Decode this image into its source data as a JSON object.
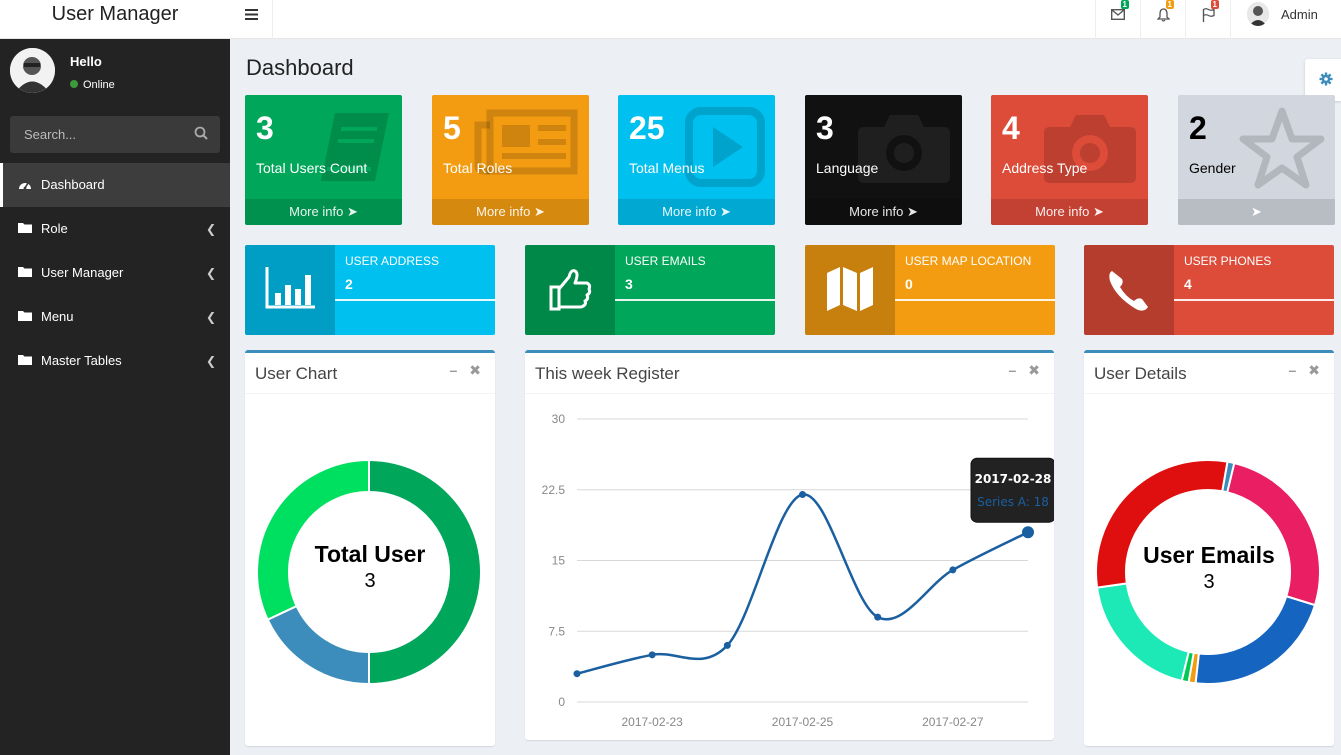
{
  "app": {
    "title": "User Manager"
  },
  "topbar": {
    "menu_icon": "hamburger-icon",
    "mail_badge": "1",
    "notif_badge": "1",
    "flag_badge": "1",
    "user_name": "Admin",
    "colors": {
      "mail_badge": "#00a65a",
      "notif_badge": "#f39c12",
      "flag_badge": "#dd4b39"
    }
  },
  "sidebar": {
    "greeting": "Hello",
    "status": "Online",
    "search_placeholder": "Search...",
    "items": [
      {
        "label": "Dashboard",
        "icon": "dashboard-icon",
        "active": true
      },
      {
        "label": "Role",
        "icon": "folder-icon"
      },
      {
        "label": "User Manager",
        "icon": "folder-icon"
      },
      {
        "label": "Menu",
        "icon": "folder-icon"
      },
      {
        "label": "Master Tables",
        "icon": "folder-icon"
      }
    ]
  },
  "page": {
    "title": "Dashboard"
  },
  "small_boxes": [
    {
      "count": "3",
      "label": "Total Users Count",
      "footer": "More info",
      "color": "#00a65a",
      "icon": "book-icon"
    },
    {
      "count": "5",
      "label": "Total Roles",
      "footer": "More info",
      "color": "#f39c12",
      "icon": "newspaper-icon"
    },
    {
      "count": "25",
      "label": "Total Menus",
      "footer": "More info",
      "color": "#00c0ef",
      "icon": "play-icon"
    },
    {
      "count": "3",
      "label": "Language",
      "footer": "More info",
      "color": "#111111",
      "icon": "camera-icon"
    },
    {
      "count": "4",
      "label": "Address Type",
      "footer": "More info",
      "color": "#dd4b39",
      "icon": "camera-icon"
    },
    {
      "count": "2",
      "label": "Gender",
      "footer": "",
      "color": "#d2d6de",
      "icon": "star-icon"
    }
  ],
  "info_boxes": [
    {
      "title": "USER ADDRESS",
      "value": "2",
      "color": "#00c0ef",
      "icon": "bar-chart-icon"
    },
    {
      "title": "USER EMAILS",
      "value": "3",
      "color": "#00a65a",
      "icon": "thumbs-up-icon"
    },
    {
      "title": "USER MAP LOCATION",
      "value": "0",
      "color": "#f39c12",
      "icon": "map-icon"
    },
    {
      "title": "USER PHONES",
      "value": "4",
      "color": "#dd4b39",
      "icon": "phone-icon"
    }
  ],
  "user_chart": {
    "title": "User Chart",
    "center_label": "Total User",
    "center_value": "3"
  },
  "week_chart": {
    "title": "This week Register"
  },
  "user_details": {
    "title": "User Details",
    "center_label": "User Emails",
    "center_value": "3"
  },
  "chart_data": [
    {
      "type": "line",
      "title": "This week Register",
      "x": [
        "2017-02-22",
        "2017-02-23",
        "2017-02-24",
        "2017-02-25",
        "2017-02-26",
        "2017-02-27",
        "2017-02-28"
      ],
      "x_tick_labels": [
        "2017-02-23",
        "2017-02-25",
        "2017-02-27"
      ],
      "y_ticks": [
        "0",
        "7.5",
        "15",
        "22.5",
        "30"
      ],
      "ylim": [
        0,
        30
      ],
      "series": [
        {
          "name": "Series A",
          "values": [
            3,
            5,
            6,
            22,
            9,
            14,
            18
          ],
          "color": "#1a5fa0"
        }
      ],
      "tooltip": {
        "title": "2017-02-28",
        "text": "Series A: 18"
      },
      "grid": true
    },
    {
      "type": "pie",
      "title": "User Chart",
      "slices": [
        {
          "value": 50,
          "color": "#00a65a"
        },
        {
          "value": 18,
          "color": "#3c8dbc"
        },
        {
          "value": 32,
          "color": "#00e060"
        }
      ]
    },
    {
      "type": "pie",
      "title": "User Details",
      "slices": [
        {
          "value": 1,
          "color": "#3c8dbc"
        },
        {
          "value": 26,
          "color": "#e91e63"
        },
        {
          "value": 22,
          "color": "#1565c0"
        },
        {
          "value": 1,
          "color": "#f39c12"
        },
        {
          "value": 1,
          "color": "#00c853"
        },
        {
          "value": 19,
          "color": "#1de9b6"
        },
        {
          "value": 30,
          "color": "#e00f0f"
        }
      ]
    }
  ]
}
